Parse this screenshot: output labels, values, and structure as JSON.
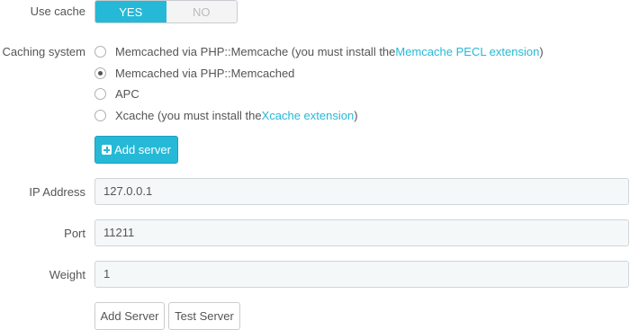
{
  "use_cache": {
    "label": "Use cache",
    "yes": "YES",
    "no": "NO",
    "value": "YES"
  },
  "caching_system": {
    "label": "Caching system",
    "options": [
      {
        "text": "Memcached via PHP::Memcache (you must install the ",
        "link": "Memcache PECL extension",
        "suffix": ")",
        "checked": false
      },
      {
        "text": "Memcached via PHP::Memcached",
        "checked": true
      },
      {
        "text": "APC",
        "checked": false
      },
      {
        "text": "Xcache (you must install the ",
        "link": "Xcache extension",
        "suffix": ")",
        "checked": false
      }
    ]
  },
  "add_server_button": "Add server",
  "fields": {
    "ip": {
      "label": "IP Address",
      "value": "127.0.0.1"
    },
    "port": {
      "label": "Port",
      "value": "11211"
    },
    "weight": {
      "label": "Weight",
      "value": "1"
    }
  },
  "buttons": {
    "add": "Add Server",
    "test": "Test Server"
  },
  "colors": {
    "accent": "#25b9d7",
    "text": "#555555",
    "input_bg": "#f5f8f9"
  }
}
